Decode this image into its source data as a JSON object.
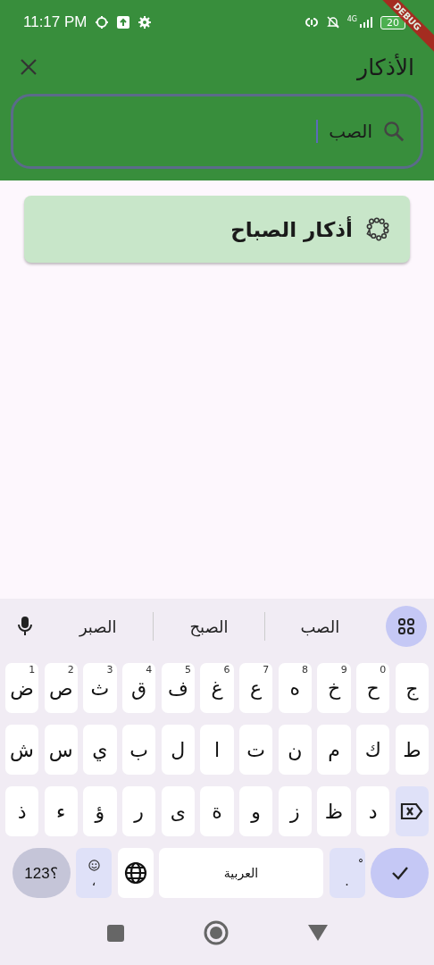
{
  "status_bar": {
    "time": "11:17 PM",
    "network": "4G",
    "battery": "20"
  },
  "debug_banner": "DEBUG",
  "app_bar": {
    "title": "الأذكار"
  },
  "search": {
    "value": "الصب"
  },
  "results": [
    {
      "title": "أذكار الصباح"
    }
  ],
  "keyboard": {
    "suggestions": [
      "الصب",
      "الصبح",
      "الصبر"
    ],
    "rows": [
      {
        "keys": [
          {
            "kind": "char",
            "label": "ج"
          },
          {
            "kind": "char",
            "label": "ح",
            "hint": "0"
          },
          {
            "kind": "char",
            "label": "خ",
            "hint": "9"
          },
          {
            "kind": "char",
            "label": "ه",
            "hint": "8"
          },
          {
            "kind": "char",
            "label": "ع",
            "hint": "7"
          },
          {
            "kind": "char",
            "label": "غ",
            "hint": "6"
          },
          {
            "kind": "char",
            "label": "ف",
            "hint": "5"
          },
          {
            "kind": "char",
            "label": "ق",
            "hint": "4"
          },
          {
            "kind": "char",
            "label": "ث",
            "hint": "3"
          },
          {
            "kind": "char",
            "label": "ص",
            "hint": "2"
          },
          {
            "kind": "char",
            "label": "ض",
            "hint": "1"
          }
        ]
      },
      {
        "keys": [
          {
            "kind": "char",
            "label": "ط"
          },
          {
            "kind": "char",
            "label": "ك"
          },
          {
            "kind": "char",
            "label": "م"
          },
          {
            "kind": "char",
            "label": "ن"
          },
          {
            "kind": "char",
            "label": "ت"
          },
          {
            "kind": "char",
            "label": "ا"
          },
          {
            "kind": "char",
            "label": "ل"
          },
          {
            "kind": "char",
            "label": "ب"
          },
          {
            "kind": "char",
            "label": "ي"
          },
          {
            "kind": "char",
            "label": "س"
          },
          {
            "kind": "char",
            "label": "ش"
          }
        ]
      },
      {
        "keys": [
          {
            "kind": "backspace"
          },
          {
            "kind": "char",
            "label": "د"
          },
          {
            "kind": "char",
            "label": "ظ"
          },
          {
            "kind": "char",
            "label": "ز"
          },
          {
            "kind": "char",
            "label": "و"
          },
          {
            "kind": "char",
            "label": "ة"
          },
          {
            "kind": "char",
            "label": "ى"
          },
          {
            "kind": "char",
            "label": "ر"
          },
          {
            "kind": "char",
            "label": "ؤ"
          },
          {
            "kind": "char",
            "label": "ء"
          },
          {
            "kind": "char",
            "label": "ذ"
          }
        ]
      },
      {
        "keys": [
          {
            "kind": "enter"
          },
          {
            "kind": "punct",
            "label": ".",
            "hint": "ْ"
          },
          {
            "kind": "space",
            "label": "العربية"
          },
          {
            "kind": "globe"
          },
          {
            "kind": "emoji",
            "label": "،"
          },
          {
            "kind": "symbols",
            "label": "؟123"
          }
        ]
      }
    ]
  }
}
